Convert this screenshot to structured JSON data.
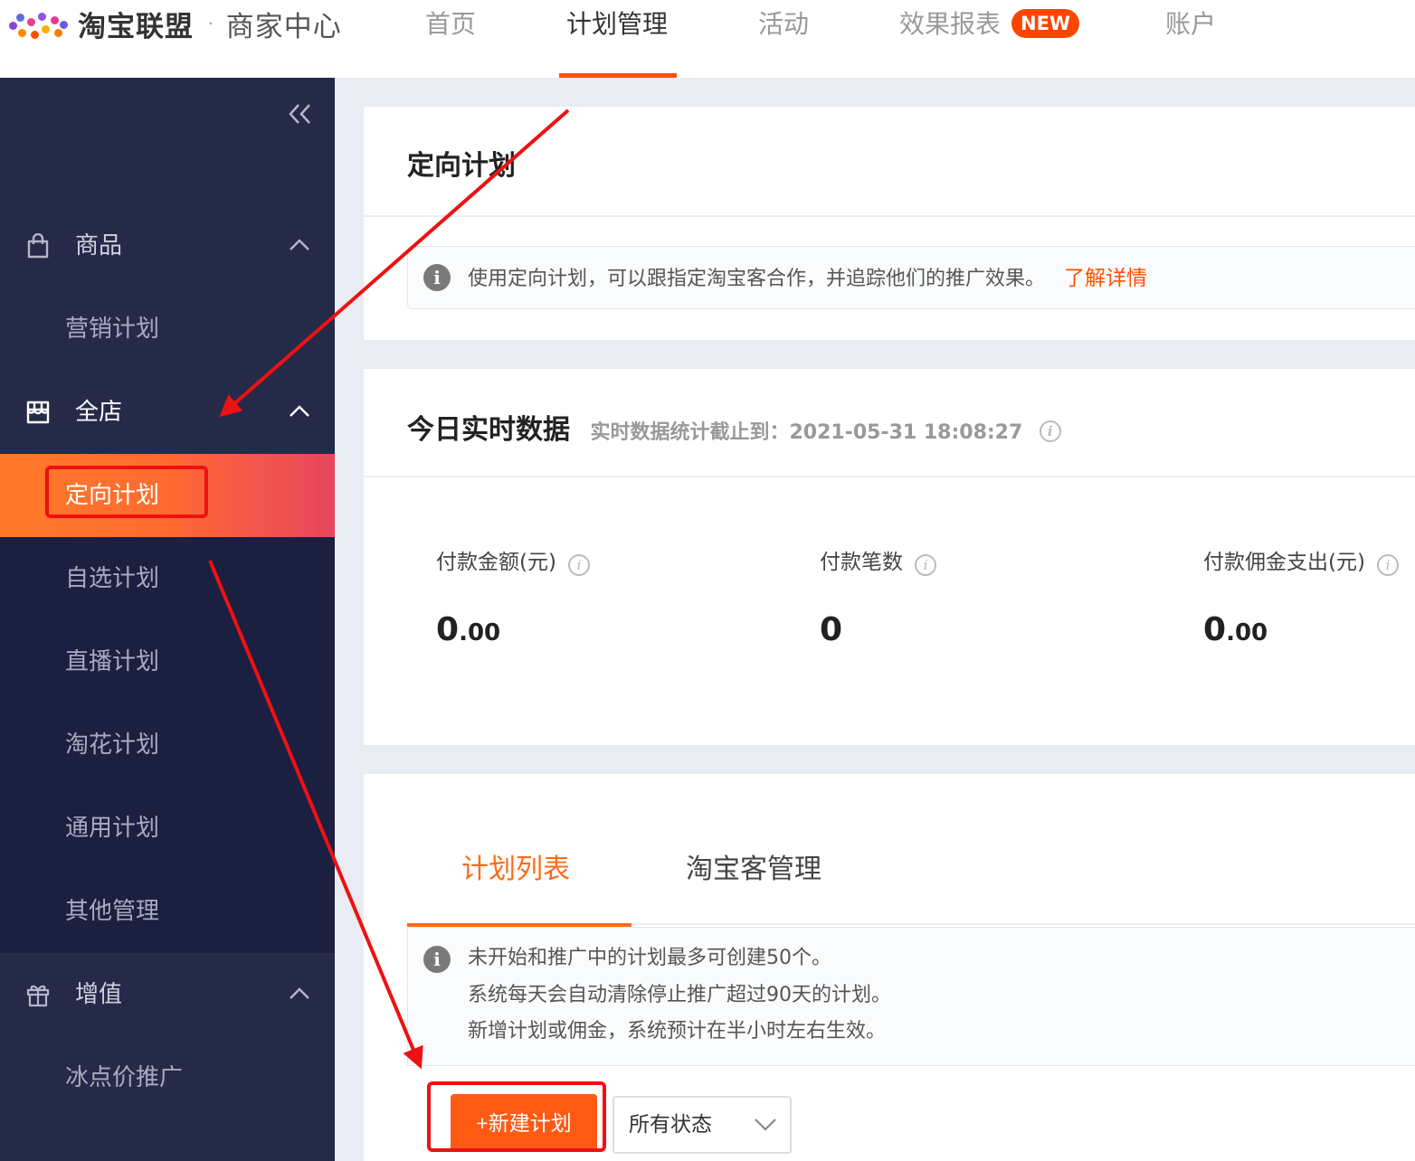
{
  "header": {
    "brand": "淘宝联盟",
    "separator": "·",
    "sub": "商家中心",
    "nav": [
      "首页",
      "计划管理",
      "活动",
      "效果报表",
      "账户"
    ],
    "active_nav": "计划管理",
    "new_badge": "NEW"
  },
  "sidebar": {
    "groups": [
      {
        "label": "商品",
        "icon": "shopping-bag-icon",
        "items": [
          "营销计划"
        ]
      },
      {
        "label": "全店",
        "icon": "store-icon",
        "items": [
          "定向计划",
          "自选计划",
          "直播计划",
          "淘花计划",
          "通用计划",
          "其他管理"
        ]
      },
      {
        "label": "增值",
        "icon": "gift-icon",
        "items": [
          "冰点价推广"
        ]
      }
    ],
    "active_item": "定向计划"
  },
  "plan_card": {
    "title": "定向计划",
    "notice": "使用定向计划，可以跟指定淘宝客合作，并追踪他们的推广效果。",
    "link": "了解详情"
  },
  "realtime": {
    "title": "今日实时数据",
    "hint_label": "实时数据统计截止到：",
    "timestamp": "2021-05-31 18:08:27",
    "metrics": [
      {
        "label": "付款金额(元)",
        "int": "0",
        "dec": ".00"
      },
      {
        "label": "付款笔数",
        "int": "0",
        "dec": ""
      },
      {
        "label": "付款佣金支出(元)",
        "int": "0",
        "dec": ".00"
      }
    ]
  },
  "list_card": {
    "tabs": [
      "计划列表",
      "淘宝客管理"
    ],
    "notice_lines": [
      "未开始和推广中的计划最多可创建50个。",
      "系统每天会自动清除停止推广超过90天的计划。",
      "新增计划或佣金，系统预计在半小时左右生效。"
    ],
    "new_button": "+新建计划",
    "status_select": "所有状态"
  },
  "colors": {
    "accent": "#ff5000",
    "sidebar_bg": "#252a48",
    "sidebar_sub_bg": "#1b1f40",
    "annotation": "#ee1111"
  }
}
